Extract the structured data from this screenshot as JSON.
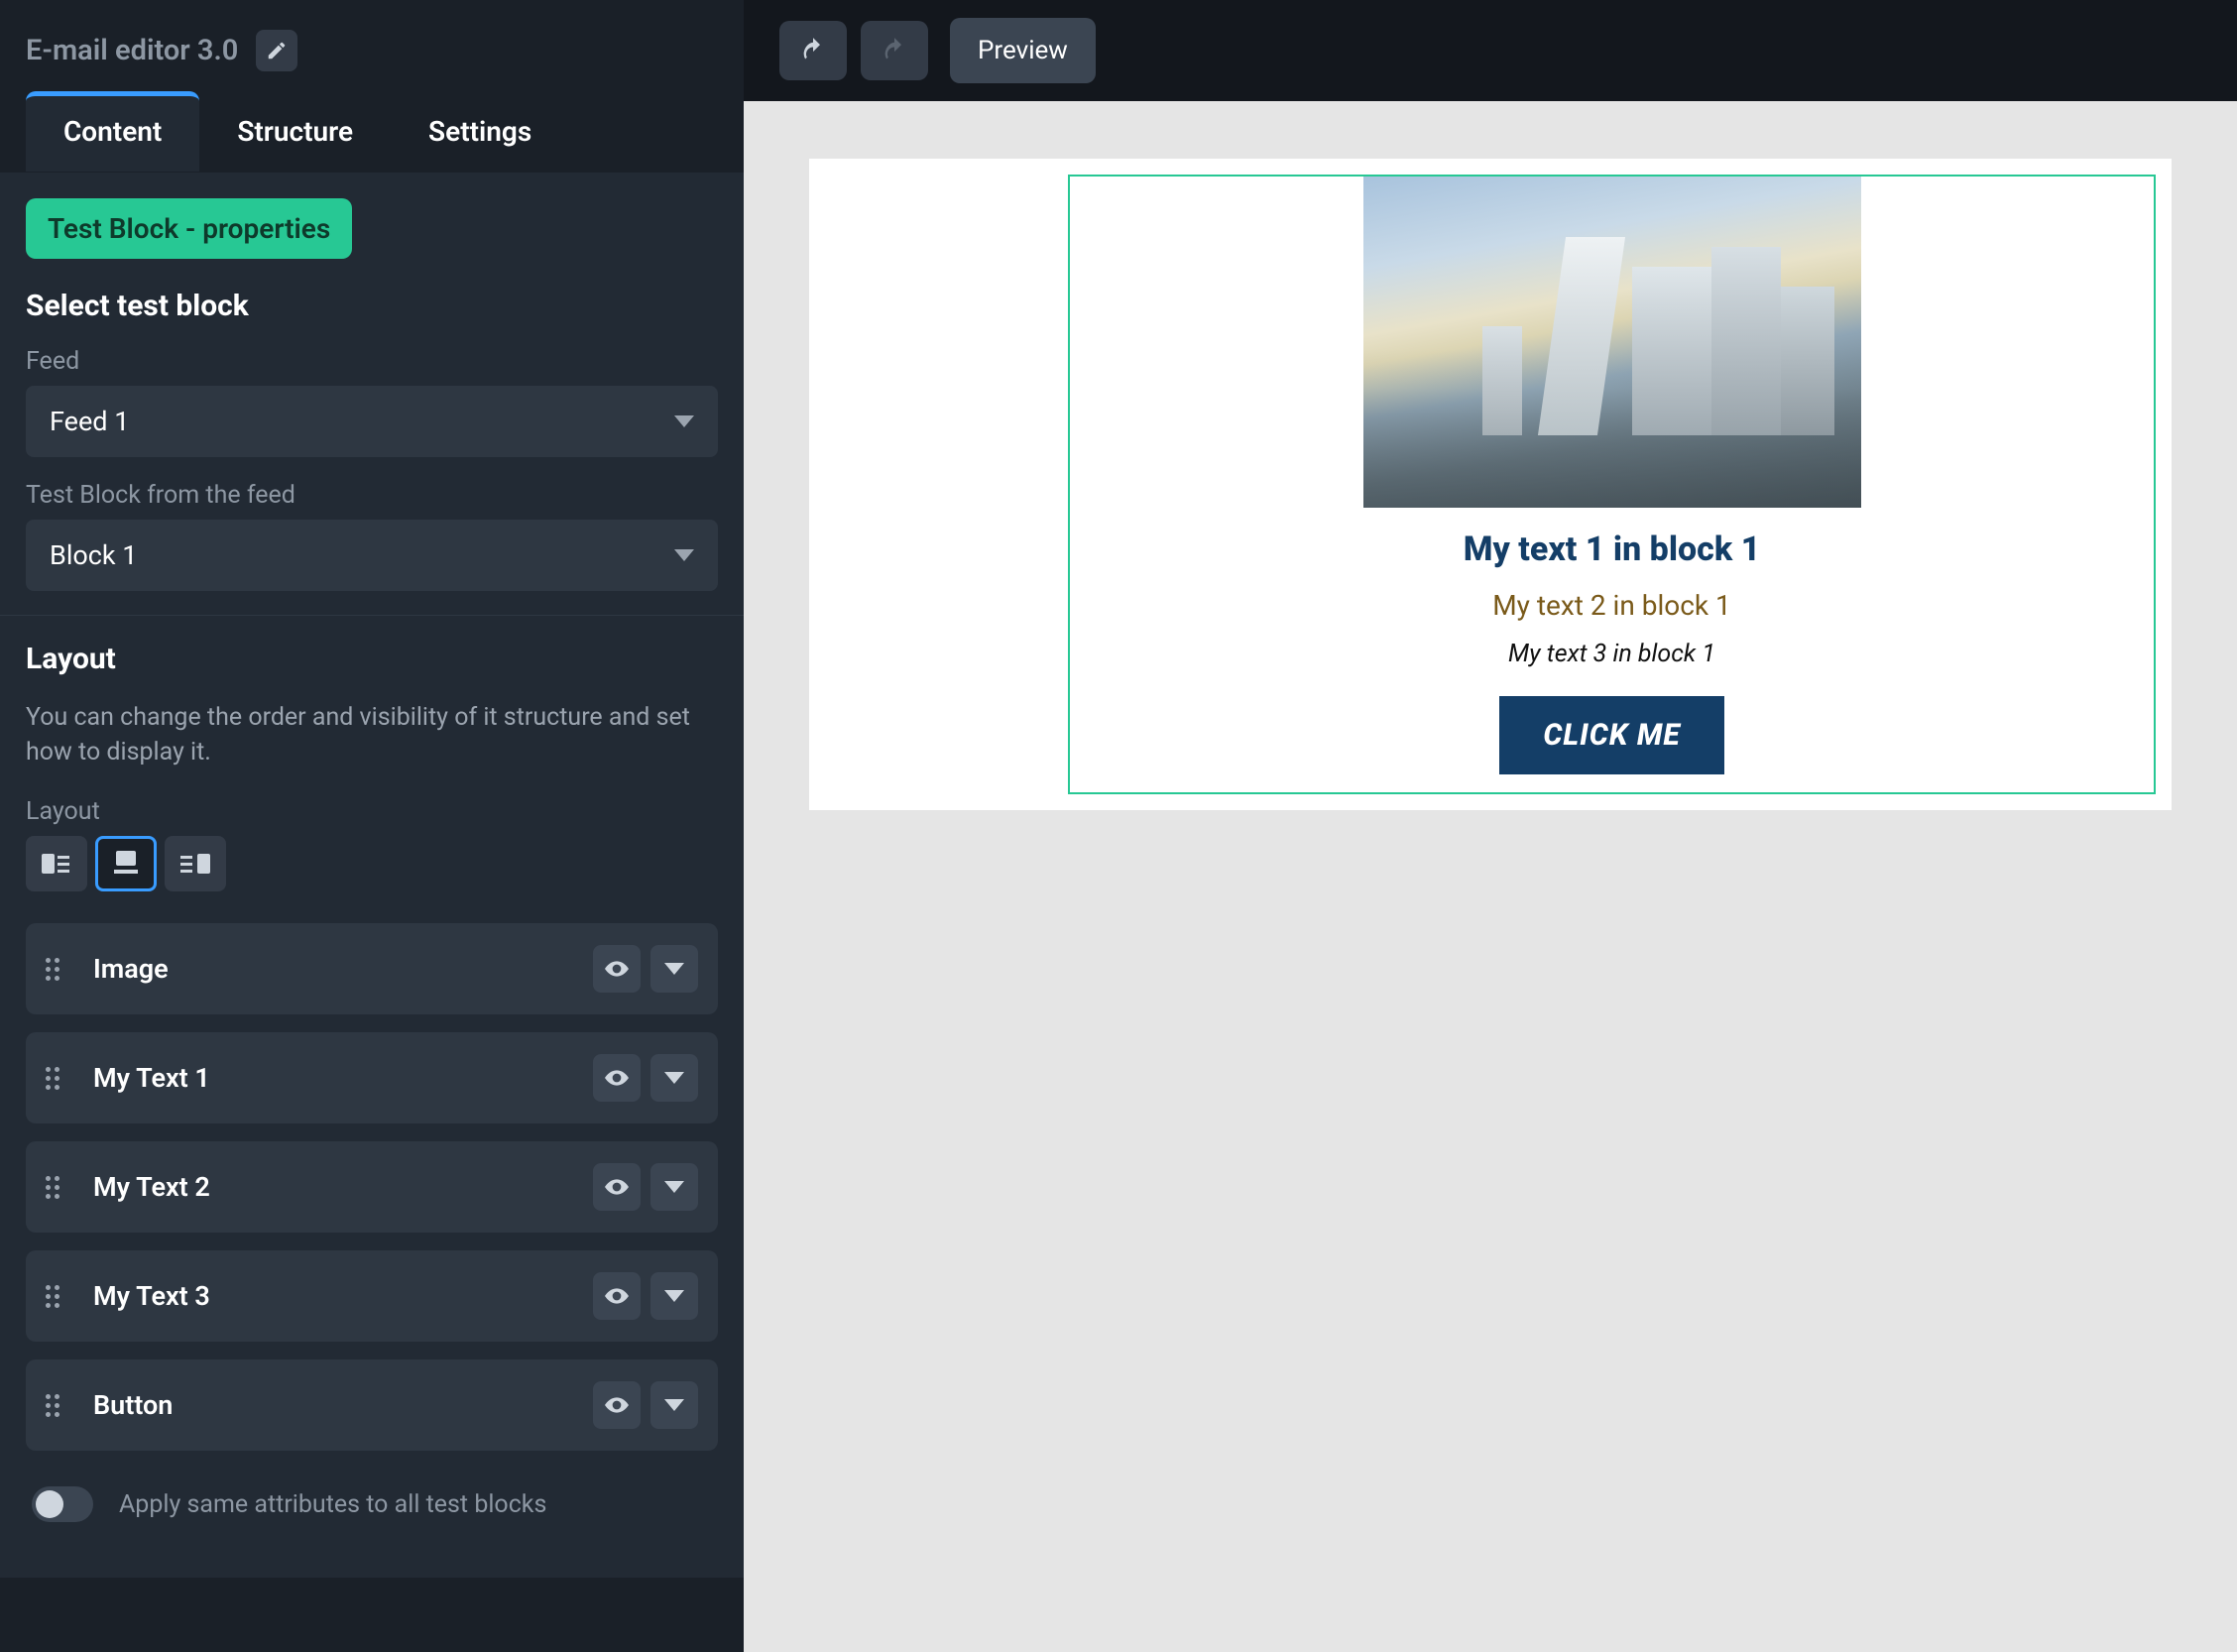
{
  "app": {
    "title": "E-mail editor 3.0"
  },
  "tabs": {
    "content": "Content",
    "structure": "Structure",
    "settings": "Settings"
  },
  "badge": "Test Block - properties",
  "select_block": {
    "title": "Select test block",
    "feed_label": "Feed",
    "feed_value": "Feed 1",
    "block_label": "Test Block from the feed",
    "block_value": "Block 1"
  },
  "layout": {
    "title": "Layout",
    "desc": "You can change the order and visibility of it structure and set how to display it.",
    "label": "Layout"
  },
  "layers": {
    "image": "Image",
    "t1": "My Text 1",
    "t2": "My Text 2",
    "t3": "My Text 3",
    "button": "Button"
  },
  "toggle_label": "Apply same attributes to all test blocks",
  "topbar": {
    "preview": "Preview"
  },
  "preview": {
    "text1": "My text 1 in block 1",
    "text2": "My text 2 in block 1",
    "text3": "My text 3 in block 1",
    "cta": "CLICK ME"
  }
}
